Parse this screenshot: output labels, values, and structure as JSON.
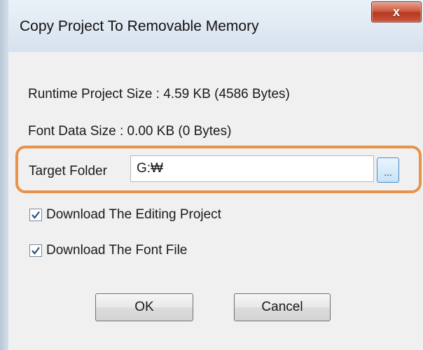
{
  "dialog": {
    "title": "Copy Project To Removable Memory",
    "close_label": "x",
    "runtime_size_text": "Runtime Project Size : 4.59 KB (4586 Bytes)",
    "font_size_text": "Font Data Size : 0.00 KB (0 Bytes)",
    "target_folder_label": "Target Folder",
    "target_folder_value": "G:₩",
    "browse_label": "...",
    "options": [
      {
        "label": "Download The Editing Project",
        "checked": true
      },
      {
        "label": "Download The Font File",
        "checked": true
      }
    ],
    "ok_label": "OK",
    "cancel_label": "Cancel"
  },
  "colors": {
    "highlight": "#e8924a",
    "close_button": "#c9543a",
    "checkmark": "#2a4f8a"
  }
}
